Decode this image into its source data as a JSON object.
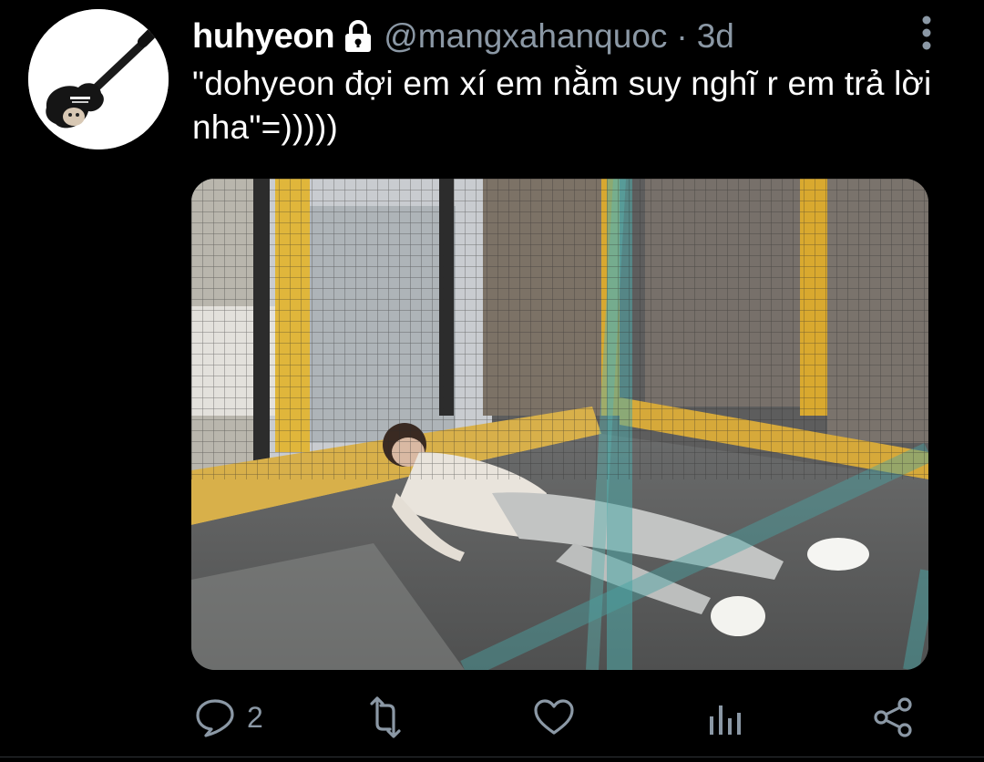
{
  "tweet": {
    "display_name": "huhyeon",
    "protected_icon": "lock-icon",
    "handle": "@mangxahanquoc",
    "separator": "·",
    "time": "3d",
    "text": "\"dohyeon đợi em xí em nằm suy nghĩ r em trả lời nha\"=)))))",
    "avatar_icon": "guitar-avatar",
    "media_description_icon": "photo"
  },
  "actions": {
    "reply_count": "2",
    "reply_icon": "reply-icon",
    "retweet_icon": "retweet-icon",
    "like_icon": "heart-icon",
    "stats_icon": "analytics-icon",
    "share_icon": "share-icon"
  },
  "colors": {
    "background": "#000000",
    "text_primary": "#ffffff",
    "text_secondary": "#8b98a5"
  }
}
